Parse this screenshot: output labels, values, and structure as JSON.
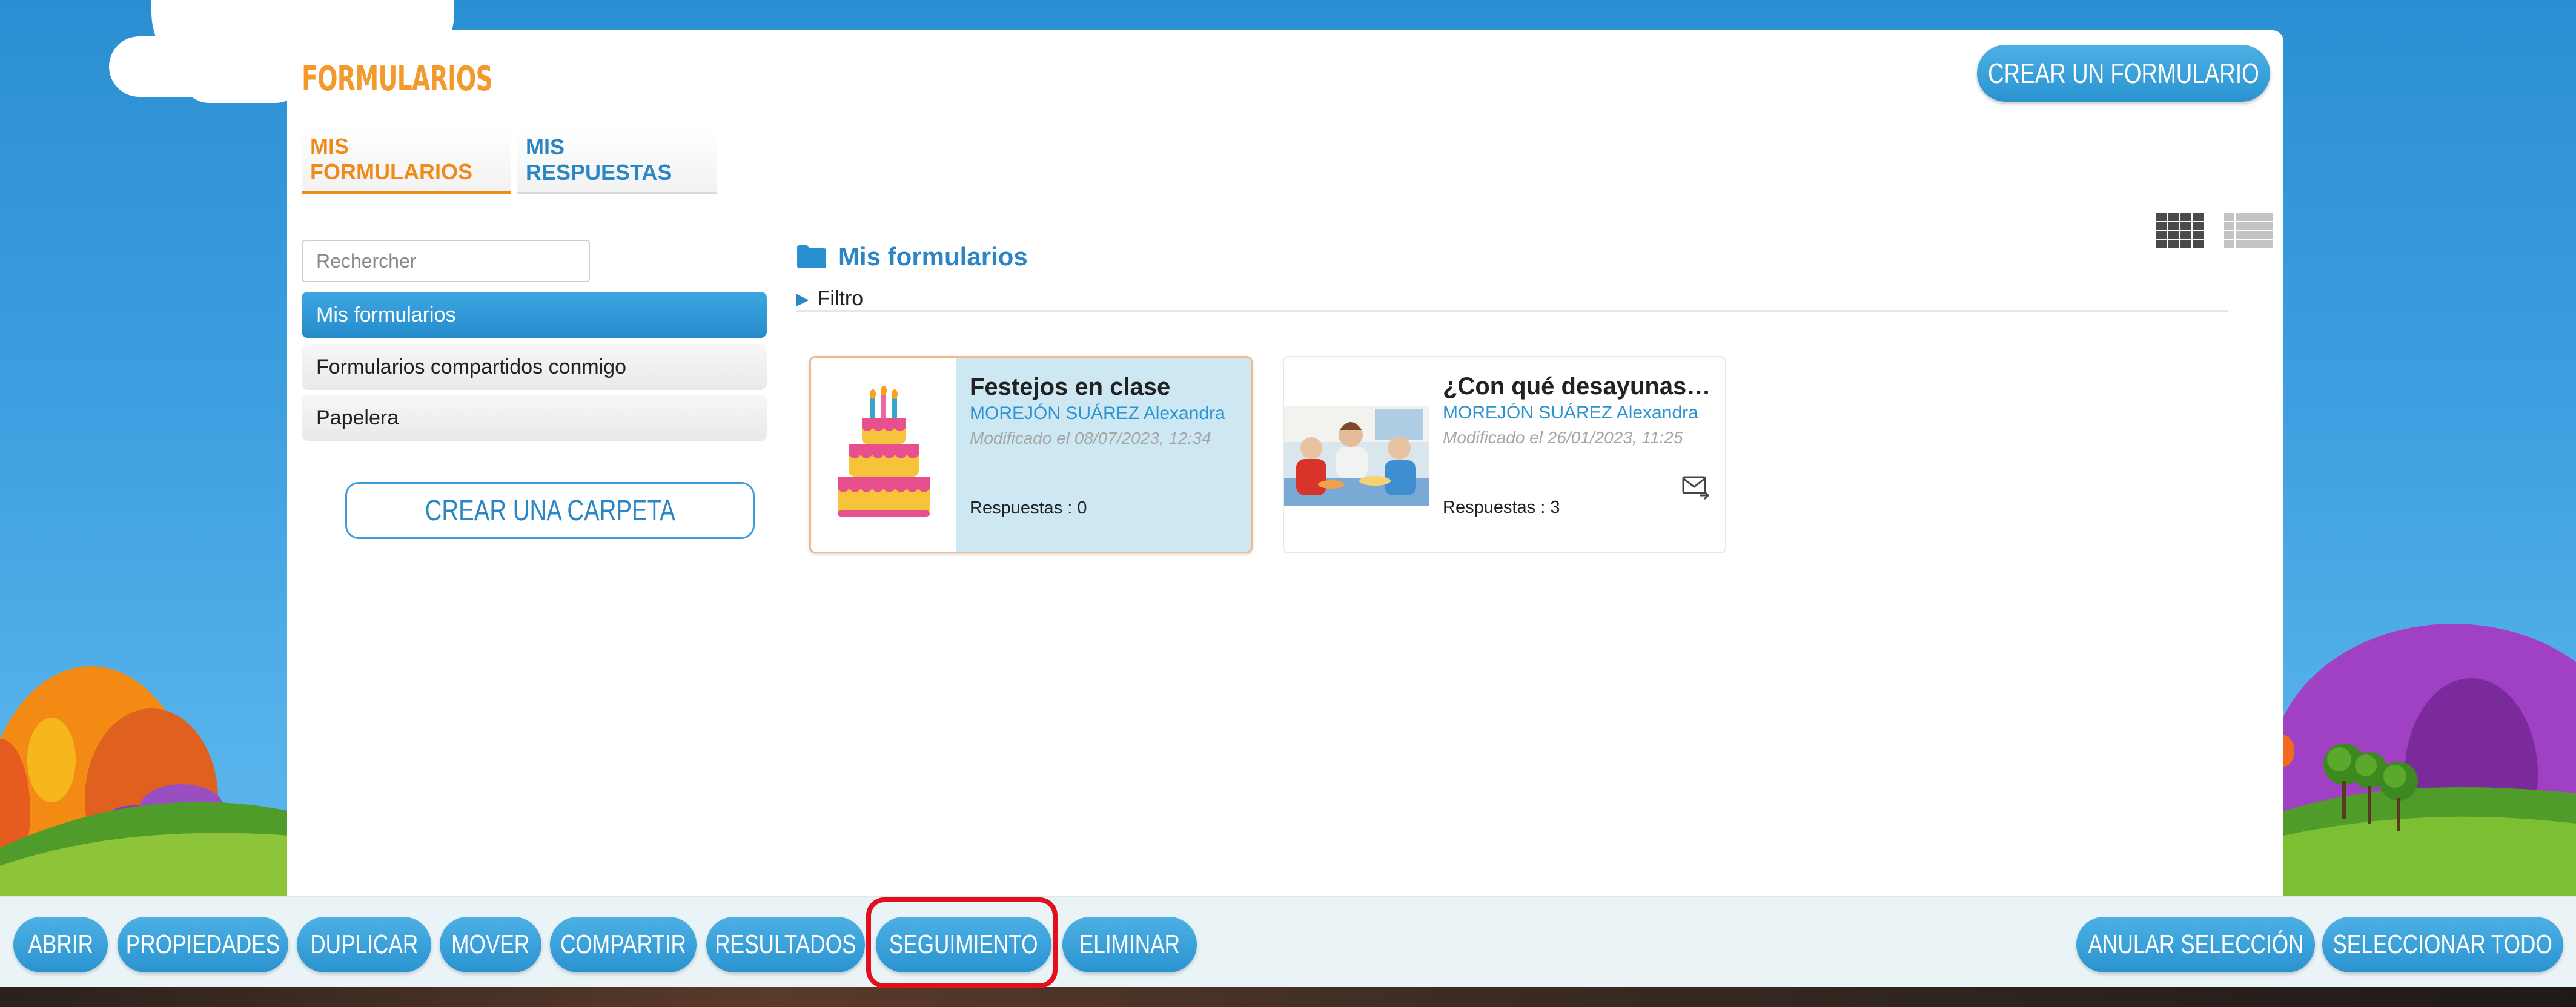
{
  "header": {
    "title": "FORMULARIOS",
    "create_form_label": "CREAR UN FORMULARIO"
  },
  "tabs": [
    {
      "label": "MIS FORMULARIOS",
      "active": true
    },
    {
      "label": "MIS RESPUESTAS",
      "active": false
    }
  ],
  "sidebar": {
    "search_placeholder": "Rechercher",
    "items": [
      {
        "label": "Mis formularios",
        "active": true
      },
      {
        "label": "Formularios compartidos conmigo",
        "active": false
      },
      {
        "label": "Papelera",
        "active": false
      }
    ],
    "create_folder_label": "CREAR UNA CARPETA"
  },
  "content": {
    "folder_title": "Mis formularios",
    "filter_label": "Filtro",
    "view_modes": [
      "grid-view-icon",
      "list-view-icon"
    ],
    "cards": [
      {
        "title": "Festejos en clase",
        "author": "MOREJÓN SUÁREZ Alexandra",
        "modified": "Modificado el 08/07/2023, 12:34",
        "responses": "Respuestas : 0",
        "thumbnail_icon": "birthday-cake-icon",
        "selected": true
      },
      {
        "title": "¿Con qué desayunas ...",
        "author": "MOREJÓN SUÁREZ Alexandra",
        "modified": "Modificado el 26/01/2023, 11:25",
        "responses": "Respuestas : 3",
        "thumbnail_icon": "children-breakfast-photo",
        "has_mail_icon": true,
        "selected": false
      }
    ]
  },
  "toolbar": {
    "buttons": [
      {
        "label": "ABRIR"
      },
      {
        "label": "PROPIEDADES"
      },
      {
        "label": "DUPLICAR"
      },
      {
        "label": "MOVER"
      },
      {
        "label": "COMPARTIR"
      },
      {
        "label": "RESULTADOS"
      },
      {
        "label": "SEGUIMIENTO",
        "highlighted": true
      },
      {
        "label": "ELIMINAR"
      },
      {
        "label": "ANULAR SELECCIÓN"
      },
      {
        "label": "SELECCIONAR TODO"
      }
    ]
  },
  "colors": {
    "accent_orange": "#f39a2e",
    "accent_blue": "#2a93d0",
    "highlight_red": "#e0111d",
    "selected_card_bg": "#cde7f3"
  }
}
